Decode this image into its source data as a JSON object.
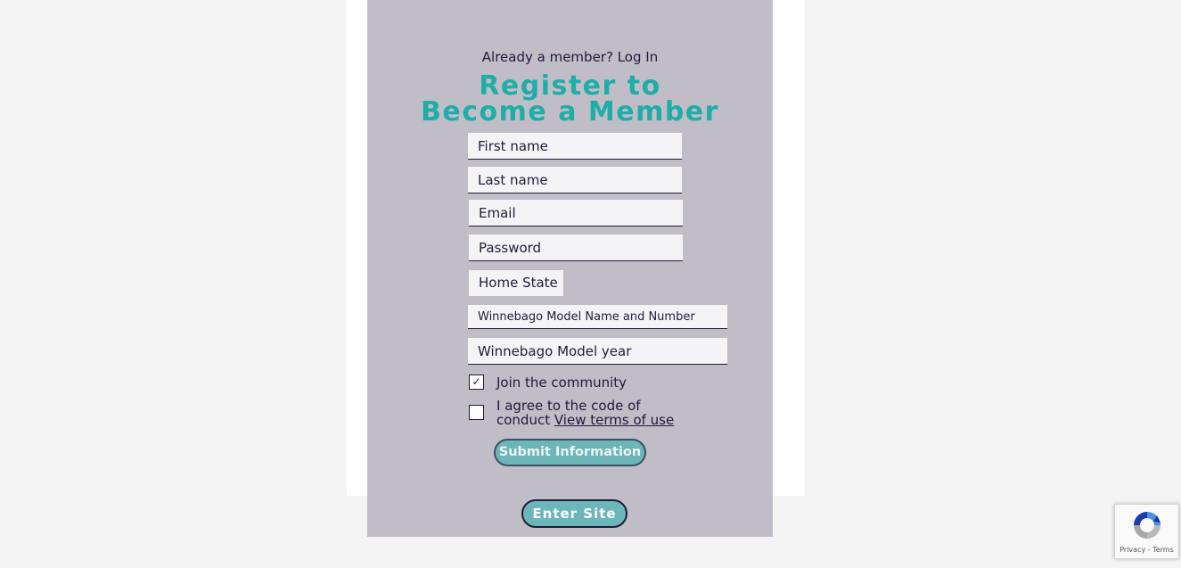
{
  "login": {
    "prompt": "Already a member?",
    "link": "Log In"
  },
  "title": "Register to Become a Member",
  "fields": {
    "first_name": "First name",
    "last_name": "Last name",
    "email": "Email",
    "password": "Password",
    "home_state": "Home State",
    "model_name": "Winnebago Model Name and Number",
    "model_year": "Winnebago Model year"
  },
  "checkboxes": {
    "join": {
      "label": "Join the community",
      "checked": true,
      "mark": "✓"
    },
    "agree": {
      "label": "I agree to the code of conduct",
      "link": "View terms of use",
      "checked": false
    }
  },
  "buttons": {
    "submit": "Submit Information",
    "enter": "Enter Site"
  },
  "recaptcha": {
    "privacy": "Privacy",
    "separator": "-",
    "terms": "Terms"
  },
  "colors": {
    "accent": "#1fada8",
    "card": "#c1bdc6",
    "button": "#6cb5b8",
    "text": "#1f1b3a"
  }
}
